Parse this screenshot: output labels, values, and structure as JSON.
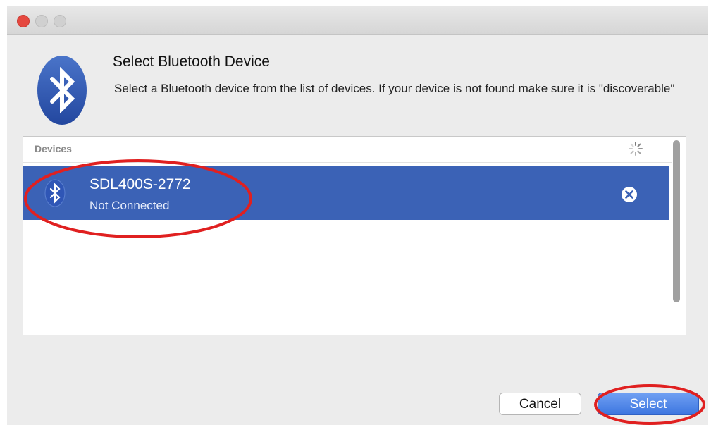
{
  "dialog": {
    "title": "Select Bluetooth Device",
    "description": "Select a Bluetooth device from the list of devices. If your device is not found make sure it is \"discoverable\""
  },
  "devices": {
    "header": "Devices",
    "items": [
      {
        "name": "SDL400S-2772",
        "status": "Not Connected",
        "selected": true
      }
    ]
  },
  "buttons": {
    "cancel": "Cancel",
    "select": "Select"
  },
  "colors": {
    "selection": "#3b62b6",
    "bluetooth_badge": "#2f56b6",
    "annotation": "#e02020"
  },
  "icons": [
    "bluetooth-icon",
    "spinner-icon",
    "remove-icon"
  ]
}
